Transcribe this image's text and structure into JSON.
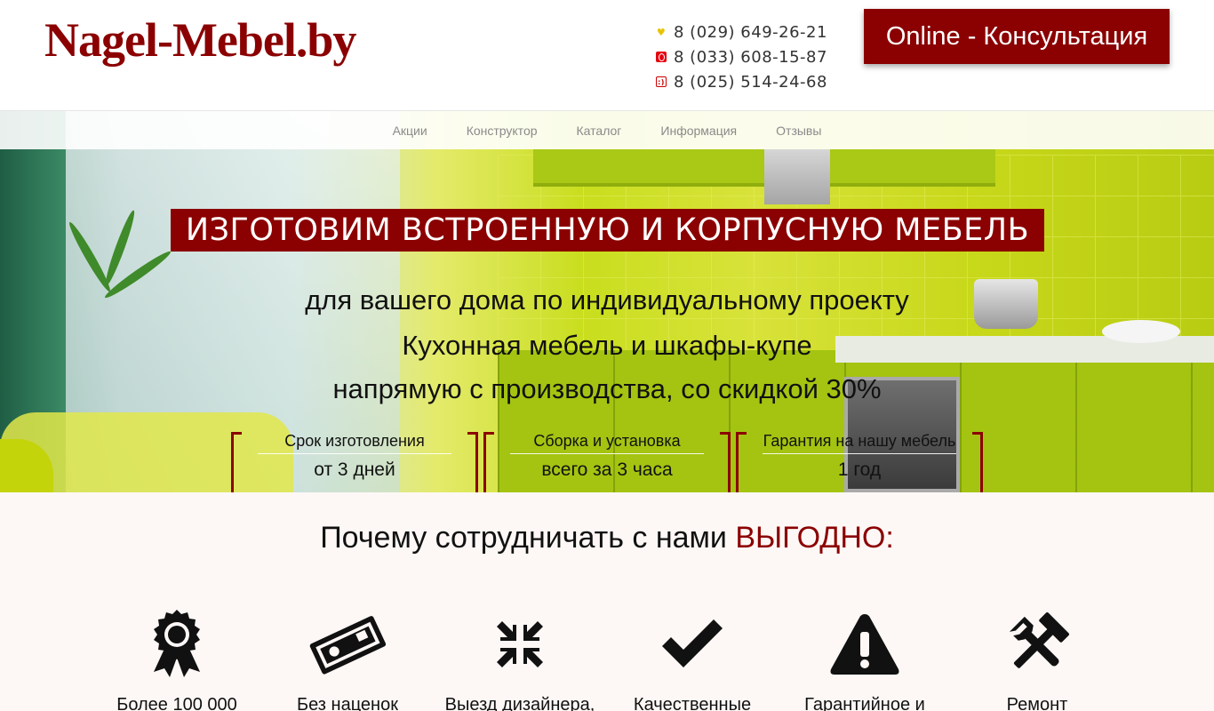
{
  "header": {
    "logo": "Nagel-Mebel.by",
    "phones": [
      {
        "operator_icon": "velcom-heart-icon",
        "number": "8 (029) 649-26-21"
      },
      {
        "operator_icon": "mts-egg-icon",
        "number": "8 (033) 608-15-87"
      },
      {
        "operator_icon": "life-icon",
        "number": "8 (025) 514-24-68"
      }
    ],
    "consult_button": "Online - Консультация"
  },
  "nav": {
    "items": [
      "Акции",
      "Конструктор",
      "Каталог",
      "Информация",
      "Отзывы"
    ]
  },
  "hero": {
    "title": "ИЗГОТОВИМ ВСТРОЕННУЮ И КОРПУСНУЮ МЕБЕЛЬ",
    "line1": "для вашего дома по индивидуальному проекту",
    "line2": "Кухонная мебель и шкафы-купе",
    "line3": "напрямую с производства, со скидкой 30%",
    "features": [
      {
        "label": "Срок изготовления",
        "value": "от 3 дней"
      },
      {
        "label": "Сборка и установка",
        "value": "всего за 3 часа"
      },
      {
        "label": "Гарантия на нашу мебель",
        "value": "1 год"
      }
    ]
  },
  "benefits": {
    "title_main": "Почему сотрудничать с нами ",
    "title_accent": "ВЫГОДНО:",
    "items": [
      {
        "icon": "award-ribbon-icon",
        "label": "Более 100 000"
      },
      {
        "icon": "money-bill-icon",
        "label": "Без наценок"
      },
      {
        "icon": "compress-arrows-icon",
        "label": "Выезд дизайнера,"
      },
      {
        "icon": "checkmark-icon",
        "label": "Качественные"
      },
      {
        "icon": "warning-triangle-icon",
        "label": "Гарантийное и"
      },
      {
        "icon": "wrench-hammer-icon",
        "label": "Ремонт"
      }
    ]
  },
  "colors": {
    "brand": "#8b0000",
    "nav_text": "#8a8a8a",
    "benefits_bg": "#fdf8f6"
  }
}
